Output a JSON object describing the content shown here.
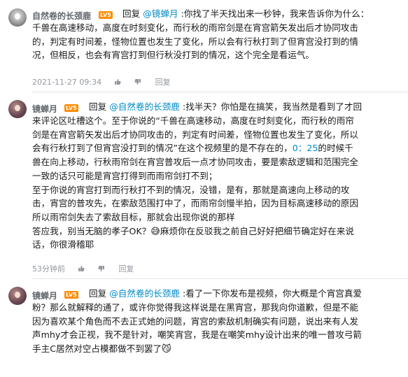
{
  "comments": [
    {
      "username": "自然卷的长颈鹿",
      "level": "LV5",
      "reply_label": "回复",
      "reply_to": "@镜蝉月",
      "lines": [
        "你找了半天找出来一秒钟，我来告诉你为什么：",
        "千兽在高速移动，高度在时刻变化，而行秋的雨帘剑是在宵宫箭矢发出后才协同攻击",
        "的，判定有时间差，怪物位置也发生了变化，所以会有行秋打到了但宵宫没打到的情",
        "况，但相反，也会有宵宫打到但行秋没打到的情况，这个完全是看运气。"
      ],
      "timestamp": "2021-11-27 09:34",
      "like_count": "",
      "dislike_label": "",
      "reply_button": "回复"
    },
    {
      "username": "镜蝉月",
      "level": "LV5",
      "reply_label": "回复",
      "reply_to": "@自然卷的长颈鹿",
      "lines": [
        "找半天？你怕是在搞笑，我当然是看到了才回",
        "来评论区吐槽这个。至于你说的“千兽在高速移动，高度在时刻变化，而行秋的雨帘",
        "剑是在宵宫箭矢发出后才协同攻击的，判定有时间差，怪物位置也发生了变化，所以",
        "会有行秋打到了但宵宫没打到的情况”在这个视频里的是不存在的，",
        "兽在向上移动，行秋雨帘剑在宵宫普攻后一点才协同攻击，要是索敌逻辑和范围完全",
        "一致的话只可能是宵宫打得到而雨帘剑打不到；",
        "至于你说的宵宫打到而行秋打不到的情况，没错，是有，那就是高速向上移动的攻",
        "击，宵宫的普攻先，在索敌范围打中了，而雨帘剑慢半拍，因为目标高速移动的原因",
        "所以雨帘剑失去了索敌目标，那就会出现你说的那样",
        "答应我，别当无脑的孝子OK？",
        "话，你很滑稽耶"
      ],
      "timestamp_inline": "0：25",
      "timestamp_tail": "的时候千",
      "emoji_text": "麻烦你在反驳我之前自己好好把细节确定好在来说",
      "timestamp": "",
      "like_count": "53",
      "dislike_label": "",
      "reply_button": "回复"
    },
    {
      "username": "镜蝉月",
      "level": "LV5",
      "reply_label": "回复",
      "reply_to": "@自然卷的长颈鹿",
      "lines": [
        "看了一下你发布是视频，你大概是个宵宫真爱",
        "粉？那么就解释的通了，或许你觉得我这样说是在黑宵宫，那我向你道歉，但是不能",
        "因为喜欢某个角色而不去正式她的问题，宵宫的索敌机制确实有问题，说出来有人发",
        "声mhy才会正视，我不是针对，嘲笑宵宫，我是在嘲笑mhy设计出来的唯一普攻弓箭",
        "手主C居然对空占模都做不到罢了"
      ]
    }
  ],
  "meta_c1": {
    "timestamp": "2021-11-27 09:34"
  },
  "meta_c2": {
    "like_count": "53分钟前",
    "reply_button": "回复"
  },
  "colors": {
    "link": "#008ac5",
    "level_badge": "#ff8c00",
    "text": "#18191c",
    "meta": "#9499a0"
  },
  "icons": [
    "avatar-cat",
    "avatar-girl",
    "like-icon",
    "dislike-icon",
    "emoji-face",
    "emoji-cat"
  ]
}
